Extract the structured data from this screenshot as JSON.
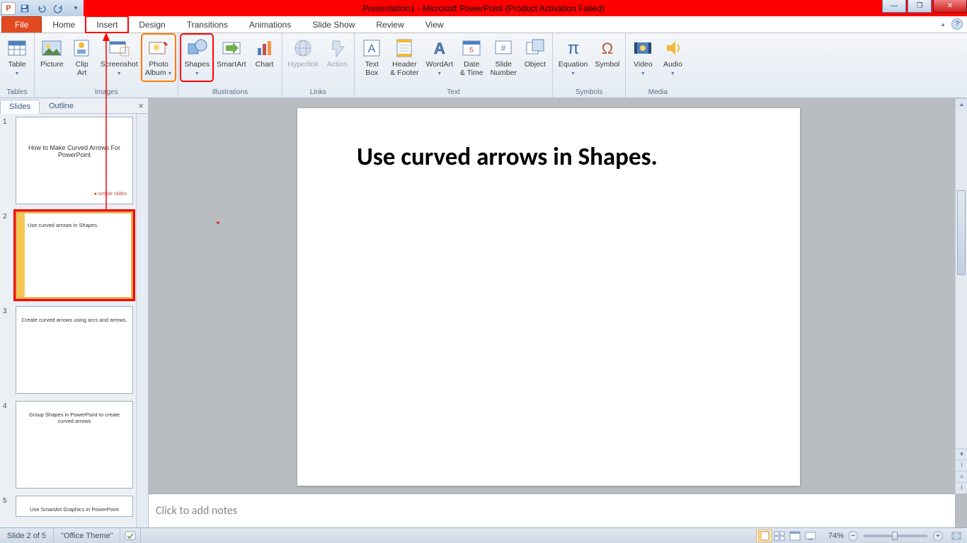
{
  "titlebar": {
    "title": "Presentation1 - Microsoft PowerPoint (Product Activation Failed)"
  },
  "tabs": {
    "file": "File",
    "items": [
      "Home",
      "Insert",
      "Design",
      "Transitions",
      "Animations",
      "Slide Show",
      "Review",
      "View"
    ],
    "active": "Insert"
  },
  "ribbon": {
    "groups": [
      {
        "label": "Tables",
        "buttons": [
          {
            "id": "table",
            "label": "Table",
            "dropdown": true
          }
        ]
      },
      {
        "label": "Images",
        "buttons": [
          {
            "id": "picture",
            "label": "Picture"
          },
          {
            "id": "clipart",
            "label": "Clip\nArt"
          },
          {
            "id": "screenshot",
            "label": "Screenshot",
            "dropdown": true
          },
          {
            "id": "photoalbum",
            "label": "Photo\nAlbum",
            "dropdown": true
          }
        ]
      },
      {
        "label": "Illustrations",
        "buttons": [
          {
            "id": "shapes",
            "label": "Shapes",
            "dropdown": true
          },
          {
            "id": "smartart",
            "label": "SmartArt"
          },
          {
            "id": "chart",
            "label": "Chart"
          }
        ]
      },
      {
        "label": "Links",
        "buttons": [
          {
            "id": "hyperlink",
            "label": "Hyperlink",
            "disabled": true
          },
          {
            "id": "action",
            "label": "Action",
            "disabled": true
          }
        ]
      },
      {
        "label": "Text",
        "buttons": [
          {
            "id": "textbox",
            "label": "Text\nBox"
          },
          {
            "id": "headerfooter",
            "label": "Header\n& Footer"
          },
          {
            "id": "wordart",
            "label": "WordArt",
            "dropdown": true
          },
          {
            "id": "datetime",
            "label": "Date\n& Time"
          },
          {
            "id": "slidenumber",
            "label": "Slide\nNumber"
          },
          {
            "id": "object",
            "label": "Object"
          }
        ]
      },
      {
        "label": "Symbols",
        "buttons": [
          {
            "id": "equation",
            "label": "Equation",
            "dropdown": true
          },
          {
            "id": "symbol",
            "label": "Symbol"
          }
        ]
      },
      {
        "label": "Media",
        "buttons": [
          {
            "id": "video",
            "label": "Video",
            "dropdown": true
          },
          {
            "id": "audio",
            "label": "Audio",
            "dropdown": true
          }
        ]
      }
    ]
  },
  "leftpanel": {
    "tabs": {
      "slides": "Slides",
      "outline": "Outline"
    },
    "thumbs": [
      {
        "n": "1",
        "title": "How to Make Curved Arrows For PowerPoint",
        "logo": "simple slides"
      },
      {
        "n": "2",
        "title": "Use curved arrows in Shapes.",
        "selected": true
      },
      {
        "n": "3",
        "title": "Create curved arrows using arcs and arrows."
      },
      {
        "n": "4",
        "title": "Group Shapes in PowerPoint to create curved arrows"
      },
      {
        "n": "5",
        "title": "Use SmartArt Graphics in PowerPoint"
      }
    ]
  },
  "slide": {
    "heading": "Use curved arrows in Shapes."
  },
  "notes": {
    "placeholder": "Click to add notes"
  },
  "status": {
    "slide": "Slide 2 of 5",
    "theme": "\"Office Theme\"",
    "zoom": "74%"
  }
}
